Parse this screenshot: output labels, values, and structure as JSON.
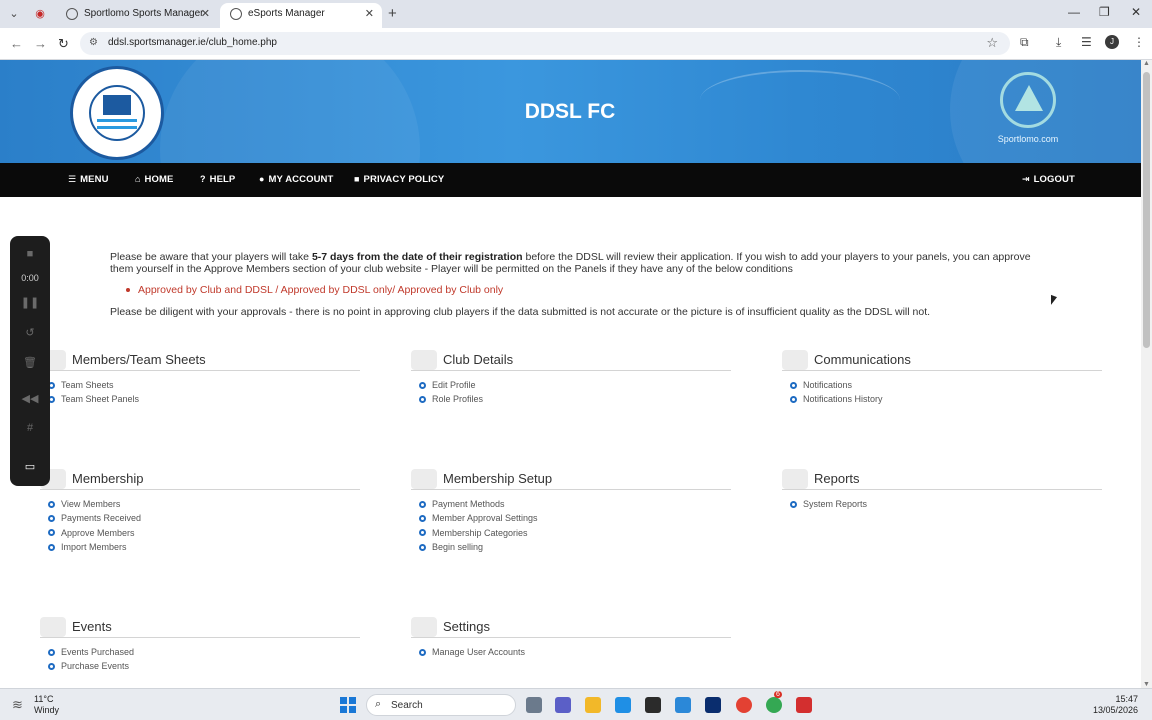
{
  "browser": {
    "tabs": [
      {
        "title": "Sportlomo Sports Manager",
        "active": false
      },
      {
        "title": "eSports Manager",
        "active": true
      }
    ],
    "url": "ddsl.sportsmanager.ie/club_home.php",
    "profile_initial": "J"
  },
  "banner": {
    "club_title": "DDSL FC",
    "partner_name": "Sportlomo.com"
  },
  "nav": {
    "menu": "MENU",
    "home": "HOME",
    "help": "HELP",
    "account": "MY ACCOUNT",
    "privacy": "PRIVACY POLICY",
    "logout": "LOGOUT"
  },
  "notice": {
    "p1_before": "Please be aware that your players will take ",
    "p1_bold": "5-7 days from the date of their registration",
    "p1_after": " before the DDSL will review their application. If you wish to add your players to your panels, you can approve them yourself in the Approve Members section of your club website - Player will be permitted on the Panels if they have any of the below conditions",
    "bullet": "Approved by Club and DDSL / Approved by DDSL only/ Approved by Club only",
    "p2": "Please be diligent with your approvals - there is no point in approving club players if the data submitted is not accurate or the picture is of insufficient quality as the DDSL will not."
  },
  "sections": {
    "members": {
      "title": "Members/Team Sheets",
      "links": [
        "Team Sheets",
        "Team Sheet Panels"
      ]
    },
    "club_details": {
      "title": "Club Details",
      "links": [
        "Edit Profile",
        "Role Profiles"
      ]
    },
    "communications": {
      "title": "Communications",
      "links": [
        "Notifications",
        "Notifications History"
      ]
    },
    "membership": {
      "title": "Membership",
      "links": [
        "View Members",
        "Payments Received",
        "Approve Members",
        "Import Members"
      ]
    },
    "membership_setup": {
      "title": "Membership Setup",
      "links": [
        "Payment Methods",
        "Member Approval Settings",
        "Membership Categories",
        "Begin selling"
      ]
    },
    "reports": {
      "title": "Reports",
      "links": [
        "System Reports"
      ]
    },
    "events": {
      "title": "Events",
      "links": [
        "Events Purchased",
        "Purchase Events"
      ]
    },
    "settings": {
      "title": "Settings",
      "links": [
        "Manage User Accounts"
      ]
    }
  },
  "recorder": {
    "time": "0:00"
  },
  "taskbar": {
    "temp": "11°C",
    "weather": "Windy",
    "search": "Search",
    "time": "15:47",
    "date": "13/05/2026",
    "badge": "6"
  },
  "colors": {
    "banner_blue": "#3b97de",
    "nav_black": "#0a0a0a",
    "link_blue": "#1e6bc2",
    "notice_red": "#c0392b"
  }
}
